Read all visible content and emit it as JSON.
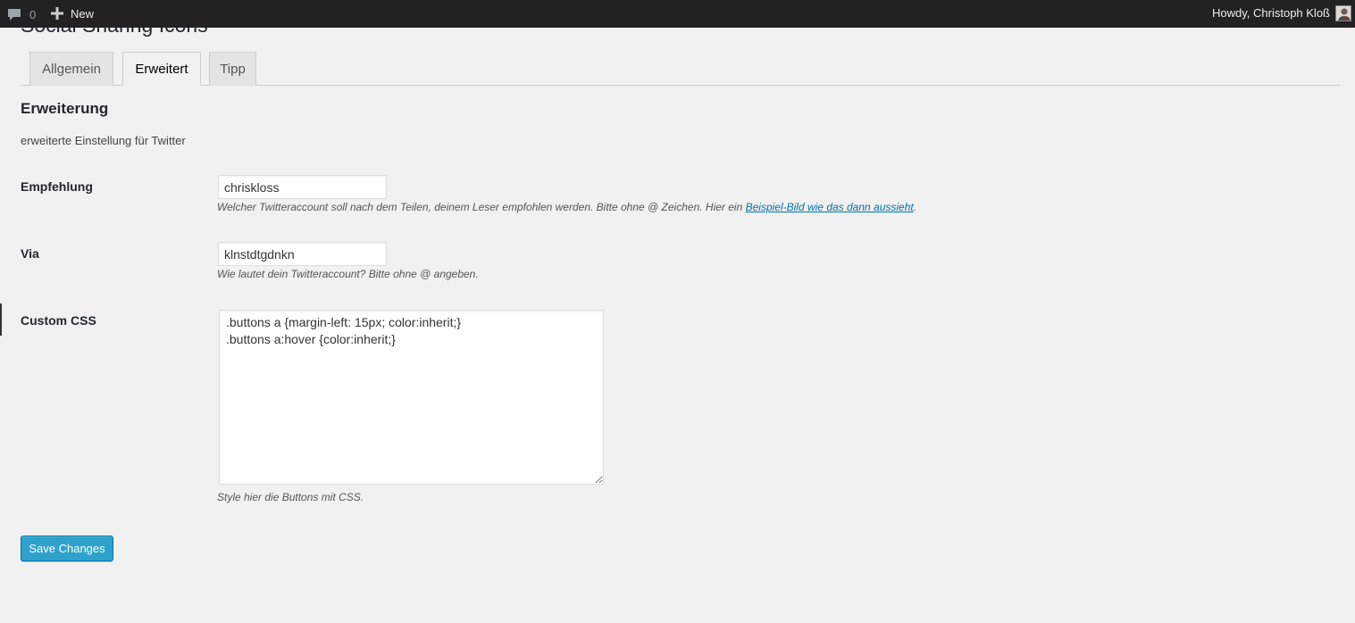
{
  "admin_bar": {
    "comments_count": "0",
    "new_label": "New",
    "howdy": "Howdy, Christoph Kloß"
  },
  "page": {
    "title": "Social Sharing Icons"
  },
  "tabs": [
    {
      "label": "Allgemein",
      "active": false
    },
    {
      "label": "Erweitert",
      "active": true
    },
    {
      "label": "Tipp",
      "active": false
    }
  ],
  "section": {
    "heading": "Erweiterung",
    "description": "erweiterte Einstellung für Twitter"
  },
  "fields": {
    "empfehlung": {
      "label": "Empfehlung",
      "value": "chriskloss",
      "desc_prefix": "Welcher Twitteraccount soll nach dem Teilen, deinem Leser empfohlen werden. Bitte ohne @ Zeichen. Hier ein ",
      "desc_link": "Beispiel-Bild wie das dann aussieht",
      "desc_suffix": "."
    },
    "via": {
      "label": "Via",
      "value": "klnstdtgdnkn",
      "desc": "Wie lautet dein Twitteraccount? Bitte ohne @ angeben."
    },
    "custom_css": {
      "label": "Custom CSS",
      "value": ".buttons a {margin-left: 15px; color:inherit;}\n.buttons a:hover {color:inherit;}",
      "desc": "Style hier die Buttons mit CSS."
    }
  },
  "actions": {
    "save_label": "Save Changes"
  },
  "colors": {
    "admin_bar_bg": "#222222",
    "page_bg": "#f1f1f1",
    "primary_button": "#2ea2cc",
    "link": "#0073aa"
  }
}
